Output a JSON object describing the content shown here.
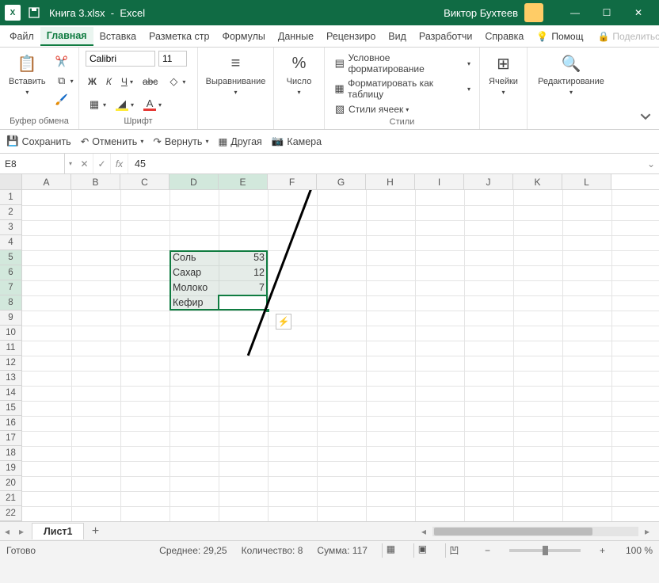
{
  "titlebar": {
    "filename": "Книга 3.xlsx",
    "app": "Excel",
    "user": "Виктор Бухтеев"
  },
  "menu": {
    "file": "Файл",
    "home": "Главная",
    "insert": "Вставка",
    "layout": "Разметка стр",
    "formulas": "Формулы",
    "data": "Данные",
    "review": "Рецензиро",
    "view": "Вид",
    "developer": "Разработчи",
    "help": "Справка",
    "help_hint": "Помощ",
    "share": "Поделиться"
  },
  "ribbon": {
    "clipboard": {
      "paste": "Вставить",
      "label": "Буфер обмена"
    },
    "font": {
      "name": "Calibri",
      "size": "11",
      "label": "Шрифт",
      "bold": "Ж",
      "italic": "К",
      "underline": "Ч"
    },
    "alignment": {
      "label": "Выравнивание"
    },
    "number": {
      "label": "Число"
    },
    "styles": {
      "cond": "Условное форматирование",
      "table": "Форматировать как таблицу",
      "cellstyles": "Стили ячеек",
      "label": "Стили"
    },
    "cells": {
      "label": "Ячейки"
    },
    "editing": {
      "label": "Редактирование"
    }
  },
  "qat": {
    "save": "Сохранить",
    "undo": "Отменить",
    "redo": "Вернуть",
    "other": "Другая",
    "camera": "Камера"
  },
  "formula": {
    "name": "E8",
    "value": "45",
    "fx": "fx"
  },
  "columns": [
    "A",
    "B",
    "C",
    "D",
    "E",
    "F",
    "G",
    "H",
    "I",
    "J",
    "K",
    "L"
  ],
  "rows_visible": 22,
  "selected_cols": [
    "D",
    "E"
  ],
  "selected_rows": [
    5,
    6,
    7,
    8
  ],
  "table": {
    "rows": [
      {
        "r": 5,
        "label": "Соль",
        "value": 53
      },
      {
        "r": 6,
        "label": "Сахар",
        "value": 12
      },
      {
        "r": 7,
        "label": "Молоко",
        "value": 7
      },
      {
        "r": 8,
        "label": "Кефир",
        "value": 45
      }
    ],
    "col_label": "D",
    "col_value": "E"
  },
  "sheet": {
    "name": "Лист1"
  },
  "status": {
    "ready": "Готово",
    "avg_label": "Среднее:",
    "avg": "29,25",
    "count_label": "Количество:",
    "count": "8",
    "sum_label": "Сумма:",
    "sum": "117",
    "zoom": "100 %"
  }
}
